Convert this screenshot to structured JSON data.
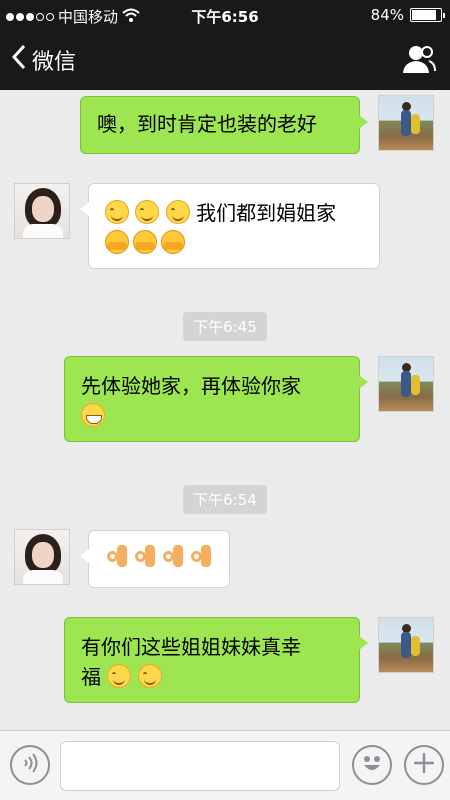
{
  "status_bar": {
    "signal_dots_filled": 3,
    "signal_dots_total": 5,
    "carrier": "中国移动",
    "wifi_icon": "wifi-icon",
    "time": "下午6:56",
    "battery_percent": "84%",
    "battery_level": 0.84
  },
  "nav": {
    "back_label": "微信",
    "back_icon": "chevron-left-icon",
    "title": "",
    "profile_icon": "person-icon"
  },
  "messages": [
    {
      "id": "m1",
      "side": "out",
      "text": "噢，到时肯定也装的老好"
    },
    {
      "id": "m2",
      "side": "in",
      "text": "我们都到娟姐家",
      "emojis_before": [
        "smile",
        "smile",
        "smile"
      ],
      "emojis_after": [
        "hug",
        "hug",
        "hug"
      ]
    },
    {
      "id": "t1",
      "type": "timestamp",
      "text": "下午6:45"
    },
    {
      "id": "m3",
      "side": "out",
      "text": "先体验她家，再体验你家",
      "emojis_after": [
        "grin"
      ]
    },
    {
      "id": "t2",
      "type": "timestamp",
      "text": "下午6:54"
    },
    {
      "id": "m4",
      "side": "in",
      "emojis": [
        "ok",
        "ok",
        "ok",
        "ok"
      ]
    },
    {
      "id": "m5",
      "side": "out",
      "text_line1": "有你们这些姐姐妹妹真幸",
      "text_line2": "福",
      "emojis_after": [
        "smile",
        "smile"
      ]
    }
  ],
  "input_bar": {
    "voice_icon": "voice-icon",
    "text_value": "",
    "emoji_icon": "emoji-face-icon",
    "plus_icon": "plus-icon"
  },
  "colors": {
    "outgoing_bubble": "#9ee552",
    "incoming_bubble": "#ffffff",
    "chat_background": "#ebebeb",
    "navbar": "#191919"
  }
}
